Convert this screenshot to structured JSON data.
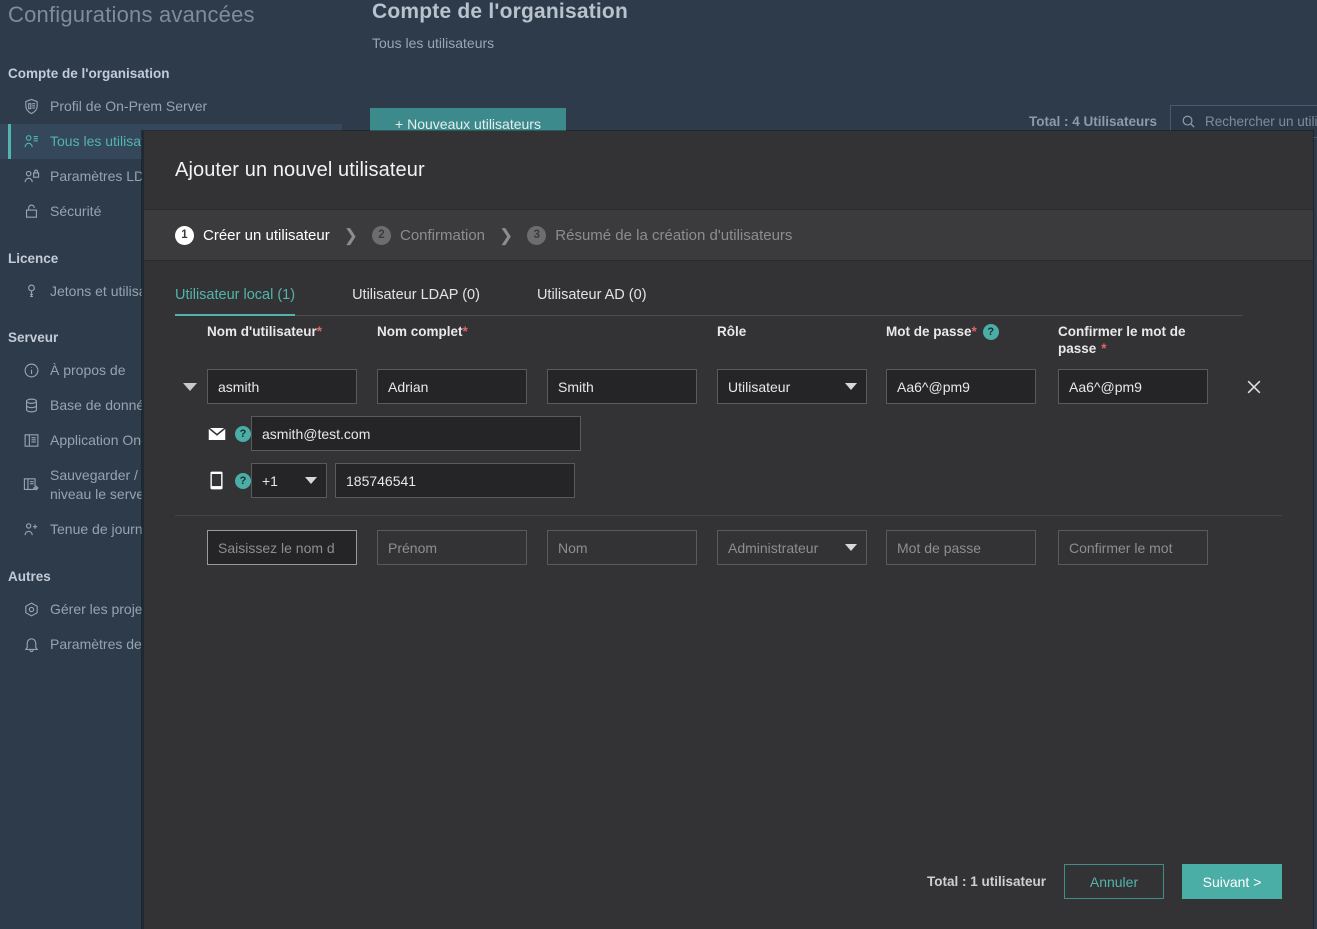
{
  "sidebar": {
    "title": "Configurations avancées",
    "groups": [
      {
        "label": "Compte de l'organisation",
        "items": [
          {
            "label": "Profil de On-Prem Server",
            "icon": "server-profile-icon",
            "active": false
          },
          {
            "label": "Tous les utilisateurs",
            "icon": "users-icon",
            "active": true
          },
          {
            "label": "Paramètres LDAP",
            "icon": "user-lock-icon",
            "active": false
          },
          {
            "label": "Sécurité",
            "icon": "lock-icon",
            "active": false
          }
        ]
      },
      {
        "label": "Licence",
        "items": [
          {
            "label": "Jetons et utilisateurs",
            "icon": "key-icon",
            "active": false
          }
        ]
      },
      {
        "label": "Serveur",
        "items": [
          {
            "label": "À propos de",
            "icon": "info-icon",
            "active": false
          },
          {
            "label": "Base de données",
            "icon": "database-icon",
            "active": false
          },
          {
            "label": "Application On-Prem",
            "icon": "application-icon",
            "active": false
          },
          {
            "label": "Sauvegarder / Mettre à niveau le serveur",
            "icon": "backup-upgrade-icon",
            "active": false
          },
          {
            "label": "Tenue de journaux",
            "icon": "log-icon",
            "active": false
          }
        ]
      },
      {
        "label": "Autres",
        "items": [
          {
            "label": "Gérer les projets",
            "icon": "projects-icon",
            "active": false
          },
          {
            "label": "Paramètres de notification",
            "icon": "bell-icon",
            "active": false
          }
        ]
      }
    ]
  },
  "page": {
    "title": "Compte de l'organisation",
    "subtitle": "Tous les utilisateurs",
    "new_users_button": "+ Nouveaux utilisateurs",
    "total_users": "Total : 4 Utilisateurs",
    "search_placeholder": "Rechercher un utilisateur"
  },
  "modal": {
    "title": "Ajouter un nouvel utilisateur",
    "steps": [
      {
        "num": "1",
        "label": "Créer un utilisateur",
        "state": "active"
      },
      {
        "num": "2",
        "label": "Confirmation",
        "state": "idle"
      },
      {
        "num": "3",
        "label": "Résumé de la création d'utilisateurs",
        "state": "idle"
      }
    ],
    "step_separator": "❯",
    "tabs": [
      {
        "label": "Utilisateur local (1)",
        "active": true
      },
      {
        "label": "Utilisateur LDAP (0)",
        "active": false
      },
      {
        "label": "Utilisateur AD (0)",
        "active": false
      }
    ],
    "columns": {
      "username": "Nom d'utilisateur",
      "fullname": "Nom complet",
      "role": "Rôle",
      "password": "Mot de passe",
      "confirm_password": "Confirmer le mot de passe",
      "required_mark": "*",
      "help_glyph": "?"
    },
    "filled_row": {
      "username": "asmith",
      "first_name": "Adrian",
      "last_name": "Smith",
      "role": "Utilisateur",
      "password": "Aa6^@pm9",
      "confirm_password": "Aa6^@pm9",
      "email": "asmith@test.com",
      "country_code": "+1",
      "phone": "185746541"
    },
    "empty_row": {
      "username_placeholder": "Saisissez le nom d",
      "first_name_placeholder": "Prénom",
      "last_name_placeholder": "Nom",
      "role_placeholder": "Administrateur",
      "password_placeholder": "Mot de passe",
      "confirm_password_placeholder": "Confirmer le mot"
    },
    "footer": {
      "total": "Total : 1 utilisateur",
      "cancel": "Annuler",
      "next": "Suivant >"
    }
  },
  "colors": {
    "accent": "#52b5ac",
    "button_primary": "#4aada6",
    "sidebar_bg": "#2e3b4a",
    "modal_bg": "#333335",
    "required_red": "#e06767"
  }
}
